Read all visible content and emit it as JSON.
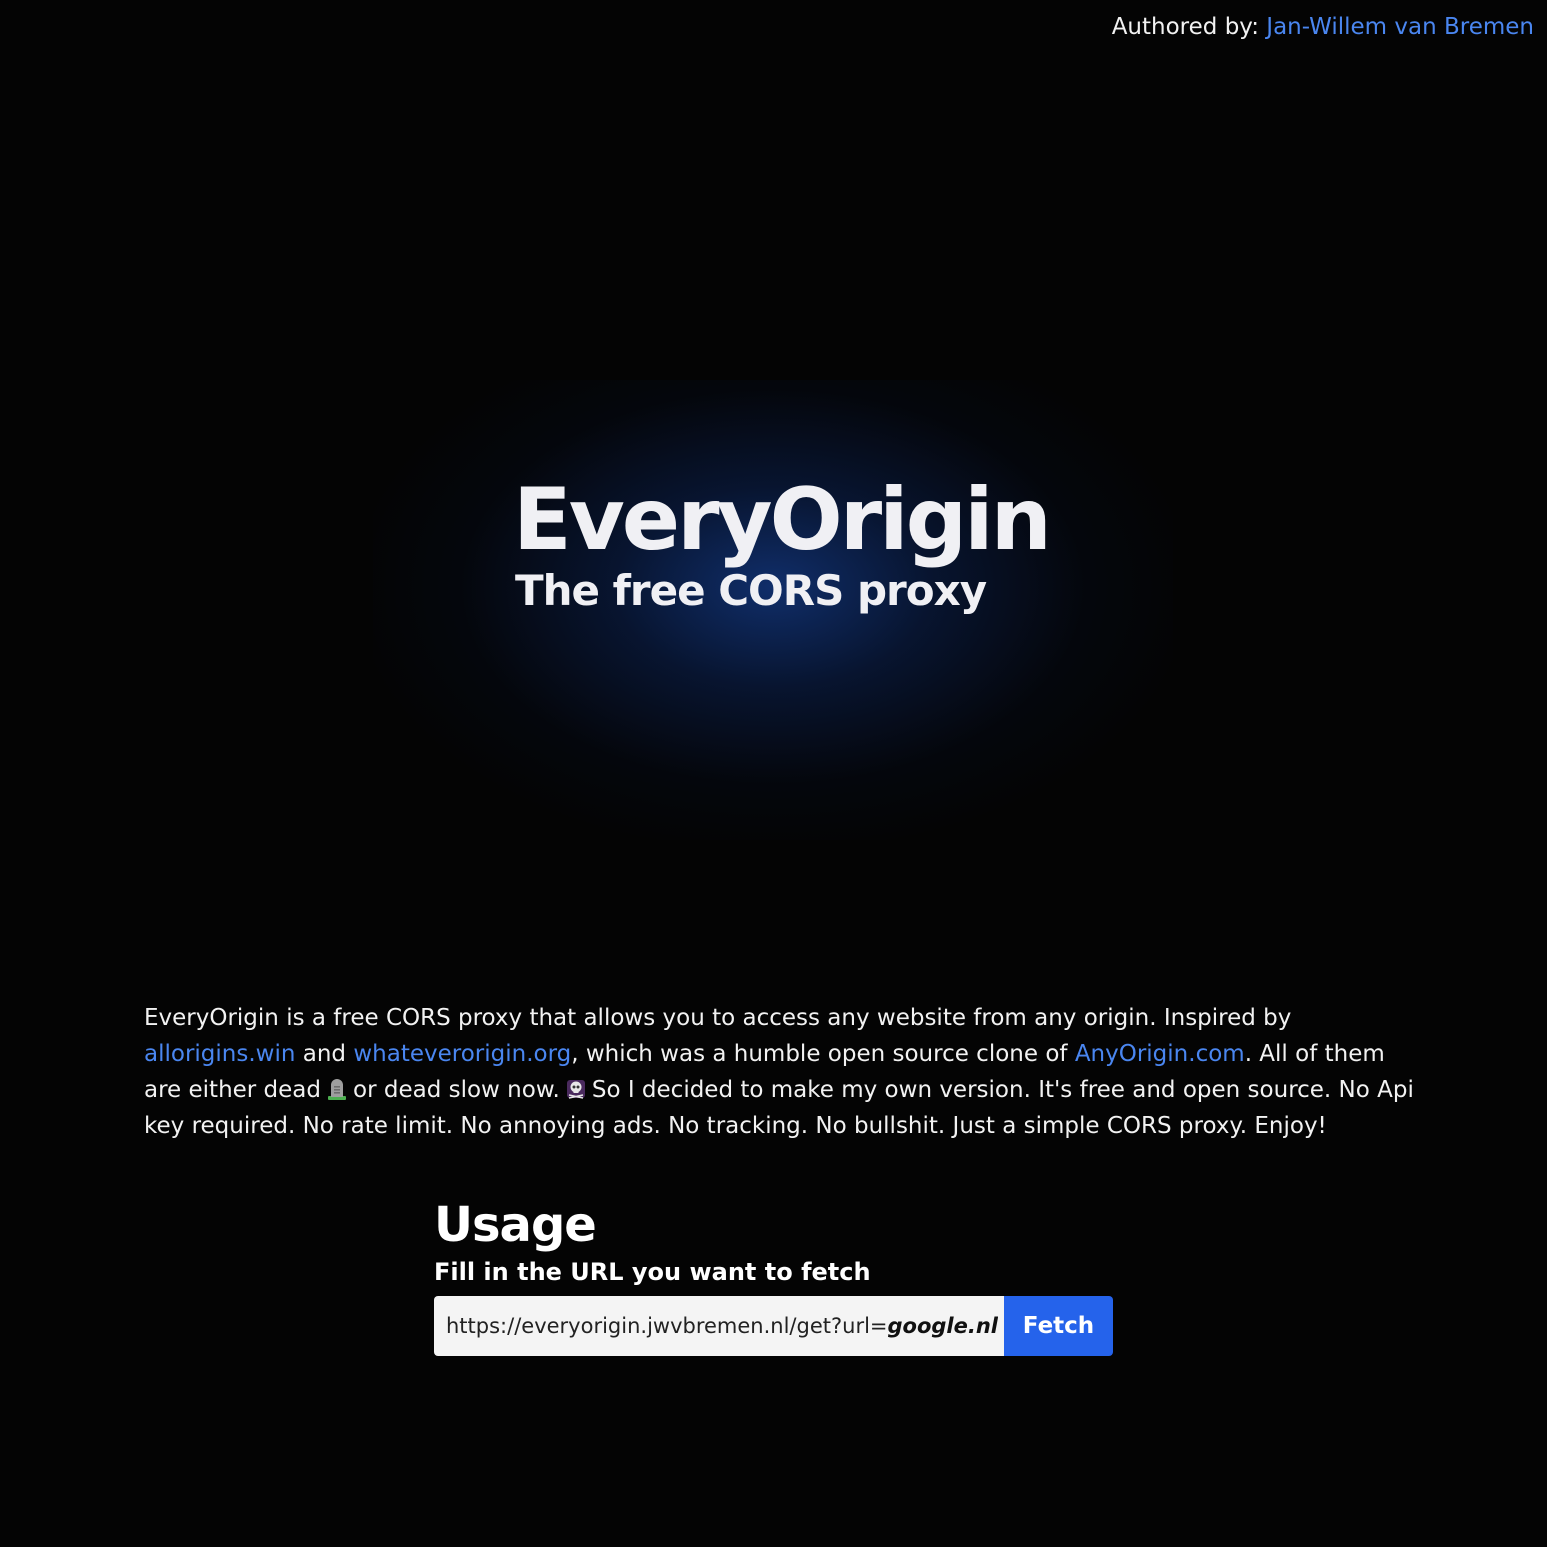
{
  "header": {
    "authored_label": "Authored by:",
    "author_name": "Jan-Willem van Bremen"
  },
  "hero": {
    "title": "EveryOrigin",
    "subtitle": "The free CORS proxy"
  },
  "intro": {
    "part1": "EveryOrigin is a free CORS proxy that allows you to access any website from any origin. Inspired by ",
    "link1": "allorigins.win",
    "part2": " and ",
    "link2": "whateverorigin.org",
    "part3": ", which was a humble open source clone of ",
    "link3": "AnyOrigin.com",
    "part4": ". All of them are either dead",
    "part5": "or dead slow now.",
    "part6": "So I decided to make my own version. It's free and open source. No Api key required. No rate limit. No annoying ads. No tracking. No bullshit. Just a simple CORS proxy. Enjoy!",
    "emoji1": "headstone-icon",
    "emoji2": "skull-crossbones-icon"
  },
  "usage": {
    "title": "Usage",
    "label": "Fill in the URL you want to fetch",
    "url_prefix": "https://everyorigin.jwvbremen.nl/get?url=",
    "url_value": "google.nl",
    "fetch_label": "Fetch"
  },
  "colors": {
    "background": "#040404",
    "link": "#4a86f0",
    "button": "#2563eb",
    "glow": "#143c8c"
  }
}
